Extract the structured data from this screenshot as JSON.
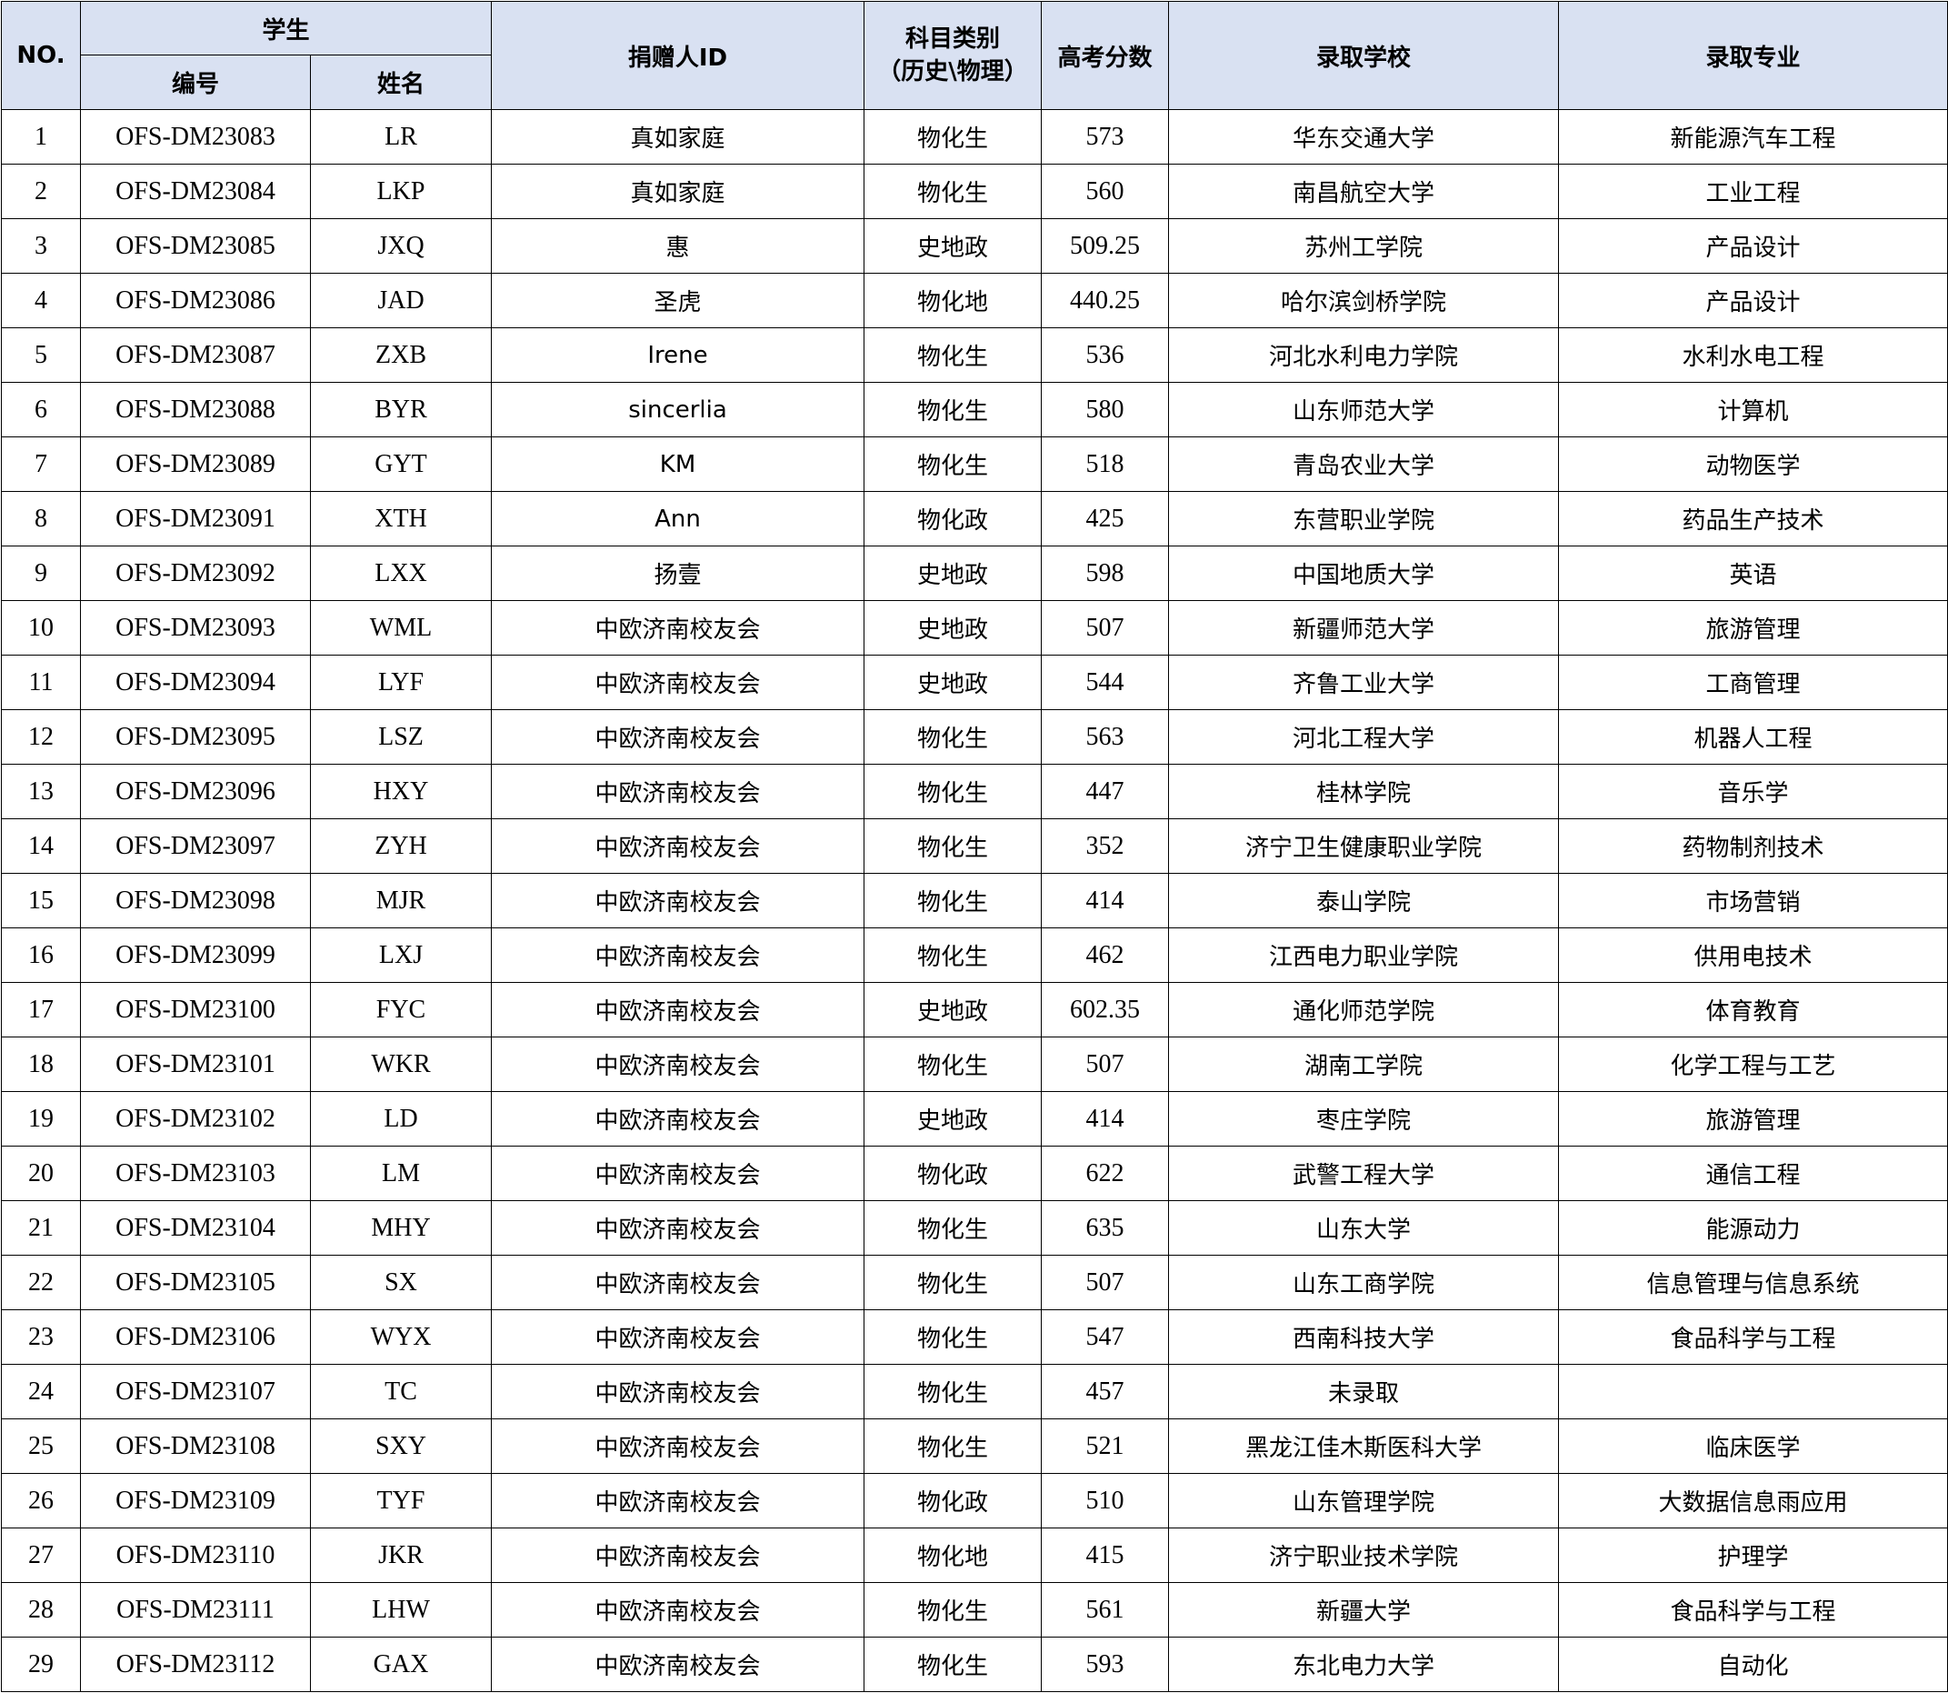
{
  "headers": {
    "no": "NO.",
    "student": "学生",
    "student_id": "编号",
    "student_name": "姓名",
    "donor_id": "捐赠人ID",
    "subject_line1": "科目类别",
    "subject_line2": "（历史\\物理）",
    "score": "高考分数",
    "school": "录取学校",
    "major": "录取专业"
  },
  "rows": [
    {
      "no": "1",
      "id": "OFS-DM23083",
      "name": "LR",
      "donor": "真如家庭",
      "subject": "物化生",
      "score": "573",
      "school": "华东交通大学",
      "major": "新能源汽车工程"
    },
    {
      "no": "2",
      "id": "OFS-DM23084",
      "name": "LKP",
      "donor": "真如家庭",
      "subject": "物化生",
      "score": "560",
      "school": "南昌航空大学",
      "major": "工业工程"
    },
    {
      "no": "3",
      "id": "OFS-DM23085",
      "name": "JXQ",
      "donor": "惠",
      "subject": "史地政",
      "score": "509.25",
      "school": "苏州工学院",
      "major": "产品设计"
    },
    {
      "no": "4",
      "id": "OFS-DM23086",
      "name": "JAD",
      "donor": "圣虎",
      "subject": "物化地",
      "score": "440.25",
      "school": "哈尔滨剑桥学院",
      "major": "产品设计"
    },
    {
      "no": "5",
      "id": "OFS-DM23087",
      "name": "ZXB",
      "donor": "Irene",
      "subject": "物化生",
      "score": "536",
      "school": "河北水利电力学院",
      "major": "水利水电工程"
    },
    {
      "no": "6",
      "id": "OFS-DM23088",
      "name": "BYR",
      "donor": "sincerlia",
      "subject": "物化生",
      "score": "580",
      "school": "山东师范大学",
      "major": "计算机"
    },
    {
      "no": "7",
      "id": "OFS-DM23089",
      "name": "GYT",
      "donor": "KM",
      "subject": "物化生",
      "score": "518",
      "school": "青岛农业大学",
      "major": "动物医学"
    },
    {
      "no": "8",
      "id": "OFS-DM23091",
      "name": "XTH",
      "donor": "Ann",
      "subject": "物化政",
      "score": "425",
      "school": "东营职业学院",
      "major": "药品生产技术"
    },
    {
      "no": "9",
      "id": "OFS-DM23092",
      "name": "LXX",
      "donor": "扬壹",
      "subject": "史地政",
      "score": "598",
      "school": "中国地质大学",
      "major": "英语"
    },
    {
      "no": "10",
      "id": "OFS-DM23093",
      "name": "WML",
      "donor": "中欧济南校友会",
      "subject": "史地政",
      "score": "507",
      "school": "新疆师范大学",
      "major": "旅游管理"
    },
    {
      "no": "11",
      "id": "OFS-DM23094",
      "name": "LYF",
      "donor": "中欧济南校友会",
      "subject": "史地政",
      "score": "544",
      "school": "齐鲁工业大学",
      "major": "工商管理"
    },
    {
      "no": "12",
      "id": "OFS-DM23095",
      "name": "LSZ",
      "donor": "中欧济南校友会",
      "subject": "物化生",
      "score": "563",
      "school": "河北工程大学",
      "major": "机器人工程"
    },
    {
      "no": "13",
      "id": "OFS-DM23096",
      "name": "HXY",
      "donor": "中欧济南校友会",
      "subject": "物化生",
      "score": "447",
      "school": "桂林学院",
      "major": "音乐学"
    },
    {
      "no": "14",
      "id": "OFS-DM23097",
      "name": "ZYH",
      "donor": "中欧济南校友会",
      "subject": "物化生",
      "score": "352",
      "school": "济宁卫生健康职业学院",
      "major": "药物制剂技术"
    },
    {
      "no": "15",
      "id": "OFS-DM23098",
      "name": "MJR",
      "donor": "中欧济南校友会",
      "subject": "物化生",
      "score": "414",
      "school": "泰山学院",
      "major": "市场营销"
    },
    {
      "no": "16",
      "id": "OFS-DM23099",
      "name": "LXJ",
      "donor": "中欧济南校友会",
      "subject": "物化生",
      "score": "462",
      "school": "江西电力职业学院",
      "major": "供用电技术"
    },
    {
      "no": "17",
      "id": "OFS-DM23100",
      "name": "FYC",
      "donor": "中欧济南校友会",
      "subject": "史地政",
      "score": "602.35",
      "school": "通化师范学院",
      "major": "体育教育"
    },
    {
      "no": "18",
      "id": "OFS-DM23101",
      "name": "WKR",
      "donor": "中欧济南校友会",
      "subject": "物化生",
      "score": "507",
      "school": "湖南工学院",
      "major": "化学工程与工艺"
    },
    {
      "no": "19",
      "id": "OFS-DM23102",
      "name": "LD",
      "donor": "中欧济南校友会",
      "subject": "史地政",
      "score": "414",
      "school": "枣庄学院",
      "major": "旅游管理"
    },
    {
      "no": "20",
      "id": "OFS-DM23103",
      "name": "LM",
      "donor": "中欧济南校友会",
      "subject": "物化政",
      "score": "622",
      "school": "武警工程大学",
      "major": "通信工程"
    },
    {
      "no": "21",
      "id": "OFS-DM23104",
      "name": "MHY",
      "donor": "中欧济南校友会",
      "subject": "物化生",
      "score": "635",
      "school": "山东大学",
      "major": "能源动力"
    },
    {
      "no": "22",
      "id": "OFS-DM23105",
      "name": "SX",
      "donor": "中欧济南校友会",
      "subject": "物化生",
      "score": "507",
      "school": "山东工商学院",
      "major": "信息管理与信息系统"
    },
    {
      "no": "23",
      "id": "OFS-DM23106",
      "name": "WYX",
      "donor": "中欧济南校友会",
      "subject": "物化生",
      "score": "547",
      "school": "西南科技大学",
      "major": "食品科学与工程"
    },
    {
      "no": "24",
      "id": "OFS-DM23107",
      "name": "TC",
      "donor": "中欧济南校友会",
      "subject": "物化生",
      "score": "457",
      "school": "未录取",
      "major": ""
    },
    {
      "no": "25",
      "id": "OFS-DM23108",
      "name": "SXY",
      "donor": "中欧济南校友会",
      "subject": "物化生",
      "score": "521",
      "school": "黑龙江佳木斯医科大学",
      "major": "临床医学"
    },
    {
      "no": "26",
      "id": "OFS-DM23109",
      "name": "TYF",
      "donor": "中欧济南校友会",
      "subject": "物化政",
      "score": "510",
      "school": "山东管理学院",
      "major": "大数据信息雨应用"
    },
    {
      "no": "27",
      "id": "OFS-DM23110",
      "name": "JKR",
      "donor": "中欧济南校友会",
      "subject": "物化地",
      "score": "415",
      "school": "济宁职业技术学院",
      "major": "护理学"
    },
    {
      "no": "28",
      "id": "OFS-DM23111",
      "name": "LHW",
      "donor": "中欧济南校友会",
      "subject": "物化生",
      "score": "561",
      "school": "新疆大学",
      "major": "食品科学与工程"
    },
    {
      "no": "29",
      "id": "OFS-DM23112",
      "name": "GAX",
      "donor": "中欧济南校友会",
      "subject": "物化生",
      "score": "593",
      "school": "东北电力大学",
      "major": "自动化"
    }
  ]
}
